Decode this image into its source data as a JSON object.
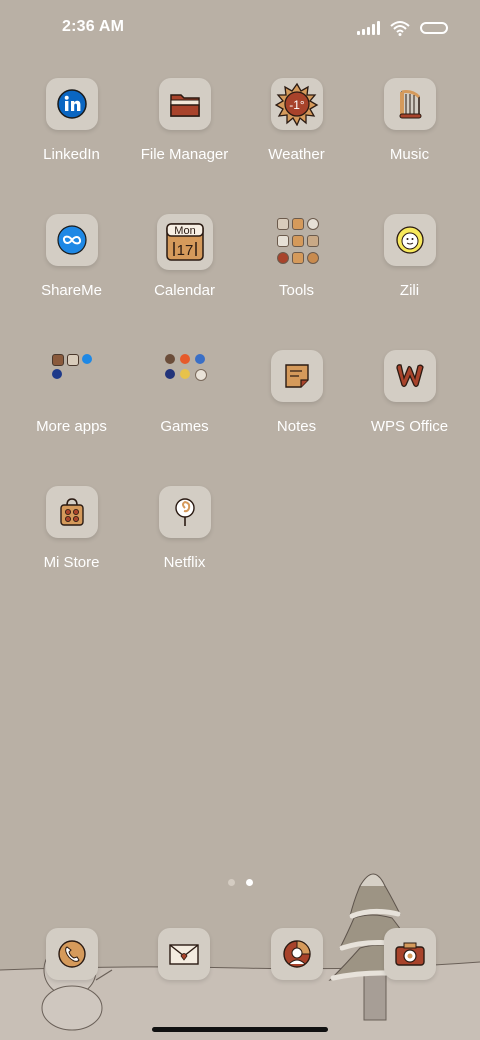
{
  "status_bar": {
    "time": "2:36 AM",
    "icons": [
      "signal-icon",
      "wifi-icon",
      "battery-icon"
    ]
  },
  "home_grid": {
    "apps": [
      {
        "label": "LinkedIn",
        "icon": "linkedin-icon"
      },
      {
        "label": "File Manager",
        "icon": "folder-icon"
      },
      {
        "label": "Weather",
        "icon": "weather-sun-icon",
        "temperature": "-1°"
      },
      {
        "label": "Music",
        "icon": "harp-icon"
      },
      {
        "label": "ShareMe",
        "icon": "shareme-icon"
      },
      {
        "label": "Calendar",
        "icon": "calendar-icon",
        "day": "Mon",
        "date": "17"
      },
      {
        "label": "Tools",
        "icon": "tools-folder-icon"
      },
      {
        "label": "Zili",
        "icon": "zili-icon"
      },
      {
        "label": "More apps",
        "icon": "more-apps-folder-icon"
      },
      {
        "label": "Games",
        "icon": "games-folder-icon"
      },
      {
        "label": "Notes",
        "icon": "sticky-note-icon"
      },
      {
        "label": "WPS Office",
        "icon": "wps-icon"
      },
      {
        "label": "Mi Store",
        "icon": "shopping-bag-icon"
      },
      {
        "label": "Netflix",
        "icon": "netflix-icon"
      }
    ]
  },
  "page_indicator": {
    "pages": 2,
    "current": 2
  },
  "dock": {
    "apps": [
      {
        "icon": "phone-icon"
      },
      {
        "icon": "mail-icon"
      },
      {
        "icon": "browser-icon"
      },
      {
        "icon": "camera-icon"
      }
    ]
  },
  "colors": {
    "background": "#b9b0a5",
    "tile": "#d3cdc4",
    "accent_brown": "#a8432b",
    "accent_tan": "#d59a5b"
  }
}
